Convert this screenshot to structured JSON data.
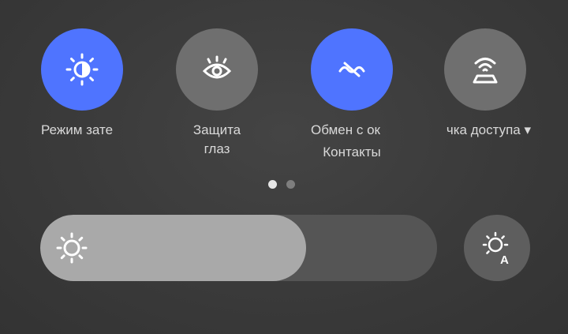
{
  "tiles": [
    {
      "label": "Режим зате",
      "sub": "",
      "icon": "brightness-contrast-icon",
      "state": "on"
    },
    {
      "label": "Защита",
      "sub": "глаз",
      "icon": "eye-icon",
      "state": "off"
    },
    {
      "label": "Обмен с ок",
      "sub": "Контакты",
      "icon": "share-wave-icon",
      "state": "on"
    },
    {
      "label": "чка доступа ▾",
      "sub": "",
      "icon": "hotspot-icon",
      "state": "off"
    }
  ],
  "pager": {
    "pages": 2,
    "current": 1
  },
  "brightness": {
    "level_fraction": 0.67,
    "icon": "sun-icon",
    "auto_icon": "auto-brightness-icon"
  },
  "colors": {
    "accent": "#4f74ff",
    "tile_off": "#6f6f6f",
    "slider_fill": "#a9a9a9",
    "slider_track": "#555555"
  }
}
